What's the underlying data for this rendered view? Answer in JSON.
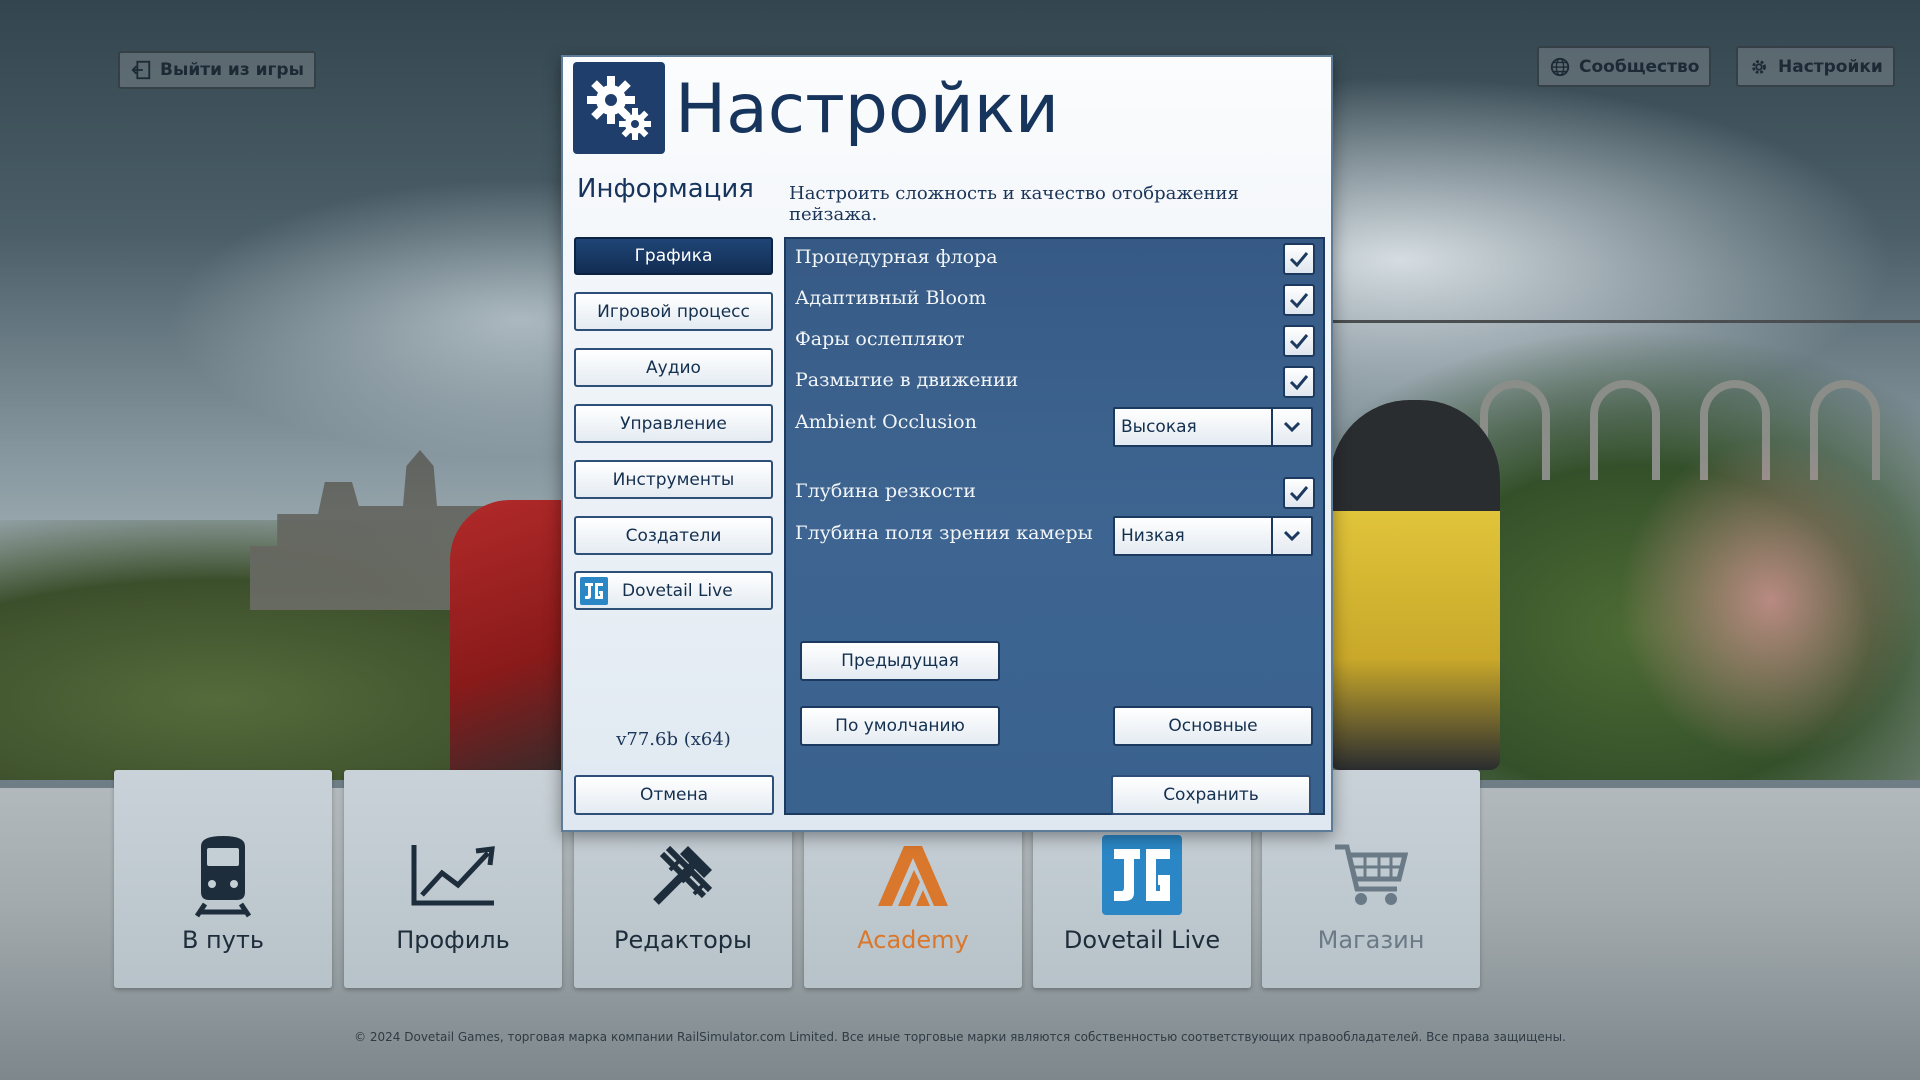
{
  "header": {
    "exit_label": "Выйти из игры",
    "community_label": "Сообщество",
    "settings_label": "Настройки"
  },
  "dialog": {
    "title": "Настройки",
    "info_title": "Информация",
    "info_text": "Настроить сложность и качество отображения пейзажа.",
    "version": "v77.6b (x64)",
    "cancel_label": "Отмена",
    "save_label": "Сохранить"
  },
  "sidebar": {
    "items": [
      {
        "label": "Графика",
        "active": true
      },
      {
        "label": "Игровой процесс",
        "active": false
      },
      {
        "label": "Аудио",
        "active": false
      },
      {
        "label": "Управление",
        "active": false
      },
      {
        "label": "Инструменты",
        "active": false
      },
      {
        "label": "Создатели",
        "active": false
      },
      {
        "label": "Dovetail Live",
        "active": false,
        "icon": "dovetail-live-logo"
      }
    ]
  },
  "options": {
    "procedural_flora": {
      "label": "Процедурная флора",
      "checked": true
    },
    "adaptive_bloom": {
      "label": "Адаптивный Bloom",
      "checked": true
    },
    "headlight_glare": {
      "label": "Фары ослепляют",
      "checked": true
    },
    "motion_blur": {
      "label": "Размытие в движении",
      "checked": true
    },
    "ambient_occlusion": {
      "label": "Ambient Occlusion",
      "value": "Высокая"
    },
    "depth_of_field": {
      "label": "Глубина резкости",
      "checked": true
    },
    "camera_dof": {
      "label": "Глубина поля зрения камеры",
      "value": "Низкая"
    }
  },
  "panel_buttons": {
    "previous": "Предыдущая",
    "defaults": "По умолчанию",
    "basic": "Основные"
  },
  "tiles": [
    {
      "label": "В путь",
      "icon": "train-icon",
      "color": "#1e2d3c"
    },
    {
      "label": "Профиль",
      "icon": "chart-icon",
      "color": "#1e2d3c"
    },
    {
      "label": "Редакторы",
      "icon": "tools-icon",
      "color": "#1e2d3c"
    },
    {
      "label": "Academy",
      "icon": "academy-icon",
      "color": "#d9772c"
    },
    {
      "label": "Dovetail Live",
      "icon": "dovetail-live-icon",
      "color": "#1e2d3c"
    },
    {
      "label": "Магазин",
      "icon": "cart-icon",
      "color": "#6b7a87"
    }
  ],
  "footer": {
    "copyright": "© 2024 Dovetail Games, торговая марка компании RailSimulator.com Limited. Все иные торговые марки являются собственностью соответствующих правообладателей. Все права защищены."
  },
  "colors": {
    "accent_dark": "#1f3e6b",
    "panel_blue": "#3e6591",
    "academy_orange": "#d9772c",
    "dovetail_blue": "#2a86c4"
  }
}
